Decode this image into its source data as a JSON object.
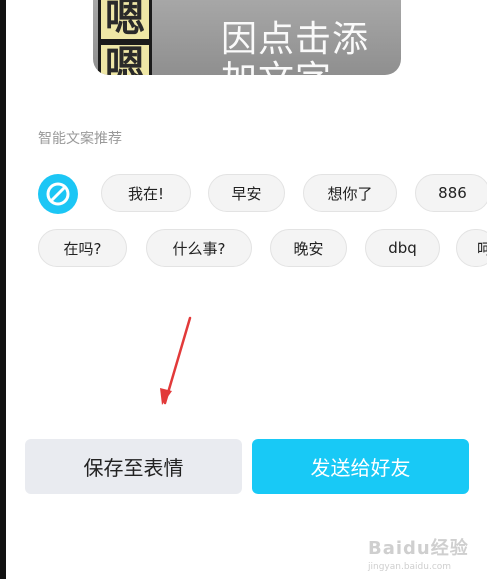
{
  "preview": {
    "sticker_glyph_top": "嗯",
    "sticker_glyph_bottom": "嗯",
    "placeholder_text": "因点击添加文字"
  },
  "recommend": {
    "title": "智能文案推荐",
    "row1": [
      "我在!",
      "早安",
      "想你了",
      "886"
    ],
    "row2": [
      "在吗?",
      "什么事?",
      "晚安",
      "dbq",
      "呵"
    ]
  },
  "actions": {
    "save_label": "保存至表情",
    "send_label": "发送给好友"
  },
  "watermark": {
    "brand": "Baidu经验",
    "url": "jingyan.baidu.com"
  },
  "colors": {
    "accent": "#18c9f6",
    "arrow": "#e23a3a"
  }
}
